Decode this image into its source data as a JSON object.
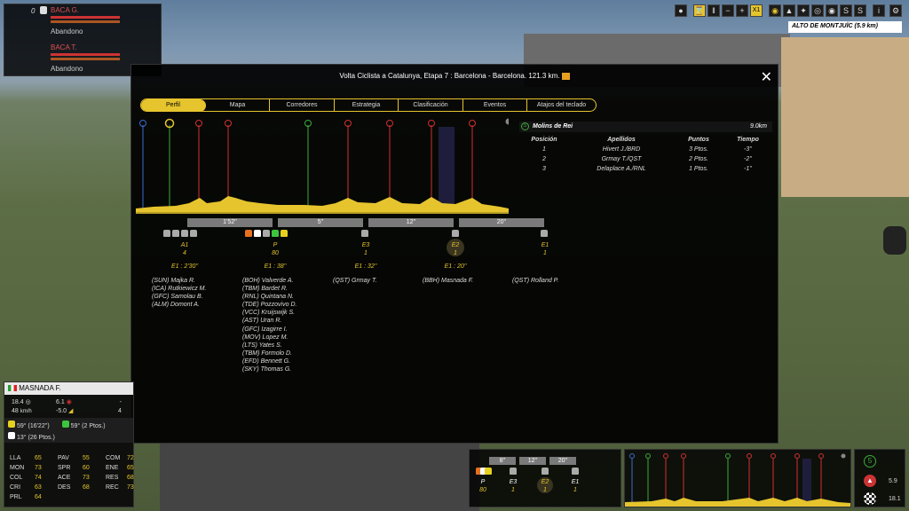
{
  "location": "ALTO DE MONTJUÏC (5.9 km)",
  "top_left": {
    "rank": "0",
    "riders": [
      {
        "name": "BACA G.",
        "status": "Abandono"
      },
      {
        "name": "BACA T.",
        "status": "Abandono"
      }
    ]
  },
  "toolbar": {
    "speed": "X1"
  },
  "modal": {
    "title": "Volta Ciclista a Catalunya, Etapa 7 : Barcelona - Barcelona. 121.3 km.",
    "tabs": [
      "Perfil",
      "Mapa",
      "Corredores",
      "Estrategia",
      "Clasificación",
      "Eventos",
      "Atajos del teclado"
    ],
    "gaps": [
      "1'52''",
      "5''",
      "12''",
      "20''"
    ],
    "groups": [
      {
        "code": "A1",
        "count": "4",
        "gap": "E1 : 2'30''",
        "riders": [
          "(SUN) Majka R.",
          "(ICA) Rutkiewicz M.",
          "(GFC) Samolau B.",
          "(ALM) Domont A."
        ]
      },
      {
        "code": "P",
        "count": "80",
        "gap": "E1 : 38''",
        "riders": [
          "(BOH) Valverde A.",
          "(TBM) Bardet R.",
          "(RNL) Quintana N.",
          "(TDE) Pozzovivo D.",
          "(VCC) Kruijswijk S.",
          "(AST) Uran R.",
          "(GFC) Izagirre I.",
          "(MOV) Lopez M.",
          "(LTS) Yates S.",
          "(TBM) Formolo D.",
          "(EFD) Bennett G.",
          "(SKY) Thomas G."
        ]
      },
      {
        "code": "E3",
        "count": "1",
        "gap": "E1 : 32''",
        "riders": [
          "(QST) Grmay T."
        ]
      },
      {
        "code": "E2",
        "count": "1",
        "gap": "E1 : 20''",
        "riders": [
          "(BBH) Masnada F."
        ]
      },
      {
        "code": "E1",
        "count": "1",
        "gap": "",
        "riders": [
          "(QST) Rolland P."
        ]
      }
    ],
    "sprint": {
      "name": "Molins de Rei",
      "distance": "9.0km",
      "headers": [
        "Posición",
        "Apellidos",
        "Puntos",
        "Tiempo"
      ],
      "rows": [
        [
          "1",
          "Hivert J./BRD",
          "3 Ptos.",
          "-3''"
        ],
        [
          "2",
          "Grmay T./QST",
          "2 Ptos.",
          "-2''"
        ],
        [
          "3",
          "Delaplace A./RNL",
          "1 Ptos.",
          "-1''"
        ]
      ]
    }
  },
  "rider_panel": {
    "name": "MASNADA F.",
    "speed": "18.4",
    "speed2": "48",
    "speed_unit": "km/h",
    "power": "6.1",
    "grade": "-5.0",
    "v1": "-",
    "v2": "4",
    "leader1": "59° (16'22'')",
    "leader2": "59° (2 Ptos.)",
    "leader3": "13° (26 Ptos.)",
    "stats": [
      [
        "LLA",
        "65"
      ],
      [
        "PAV",
        "55"
      ],
      [
        "COM",
        "72"
      ],
      [
        "MON",
        "73"
      ],
      [
        "SPR",
        "60"
      ],
      [
        "ENE",
        "65"
      ],
      [
        "COL",
        "74"
      ],
      [
        "ACE",
        "73"
      ],
      [
        "RES",
        "68"
      ],
      [
        "CRI",
        "63"
      ],
      [
        "DES",
        "68"
      ],
      [
        "REC",
        "73"
      ],
      [
        "PRL",
        "64"
      ]
    ]
  },
  "mini": {
    "gaps": [
      "8''",
      "12''",
      "20''"
    ],
    "groups": [
      [
        "P",
        "80"
      ],
      [
        "E3",
        "1"
      ],
      [
        "E2",
        "1"
      ],
      [
        "E1",
        "1"
      ]
    ]
  },
  "right_info": {
    "sprint_badge": "5",
    "value1": "5.9",
    "value2": "18.1"
  }
}
